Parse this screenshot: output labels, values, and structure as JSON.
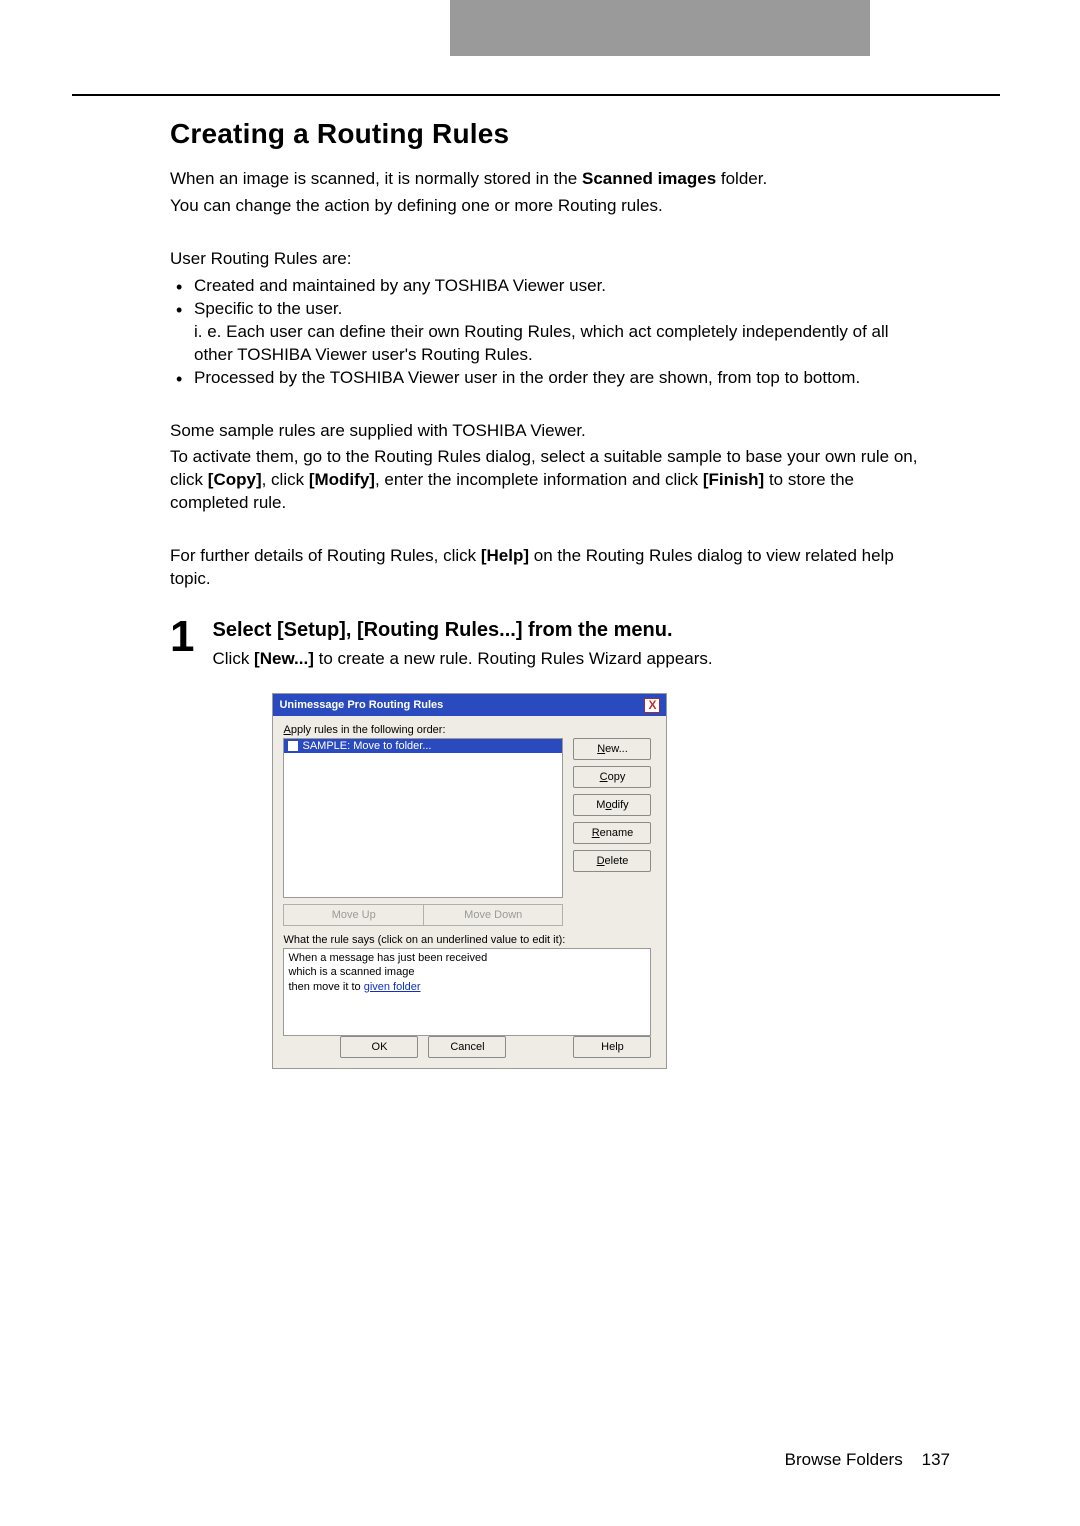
{
  "headerTab": "",
  "title": "Creating a Routing Rules",
  "intro1_pre": "When an image is scanned, it is normally stored in the ",
  "intro1_bold": "Scanned images",
  "intro1_post": " folder.",
  "intro2": "You can change the action by defining one or more Routing rules.",
  "rulesLabel": "User Routing Rules are:",
  "bullets": {
    "b1": "Created and maintained by any TOSHIBA Viewer user.",
    "b2": "Specific to the user.",
    "b2sub": "i. e. Each user can define their own Routing Rules, which act completely independently of all other TOSHIBA Viewer user's Routing Rules.",
    "b3": "Processed by the TOSHIBA Viewer user in the order they are shown, from top to bottom."
  },
  "sampleP1": "Some sample rules are supplied with TOSHIBA Viewer.",
  "sampleP2_pre": "To activate them, go to the Routing Rules dialog, select a suitable sample to base your own rule on, click ",
  "sampleP2_copy": "[Copy]",
  "sampleP2_mid1": ", click ",
  "sampleP2_modify": "[Modify]",
  "sampleP2_mid2": ", enter the incomplete information and click ",
  "sampleP2_finish": "[Finish]",
  "sampleP2_post": " to store the completed rule.",
  "helpP_pre": "For further details of Routing Rules, click ",
  "helpP_bold": "[Help]",
  "helpP_post": " on the Routing Rules dialog to view related help topic.",
  "step": {
    "num": "1",
    "title": "Select [Setup], [Routing Rules...] from the menu.",
    "body_pre": "Click ",
    "body_bold": "[New...]",
    "body_post": " to create a new rule. Routing Rules Wizard appears."
  },
  "dialog": {
    "title": "Unimessage Pro Routing Rules",
    "close": "X",
    "applyLabel_pre": "A",
    "applyLabel_post": "pply rules in the following order:",
    "selectedRule": "SAMPLE: Move to folder...",
    "buttons": {
      "new_u": "N",
      "new_rest": "ew...",
      "copy_u": "C",
      "copy_rest": "opy",
      "modify_pre": "M",
      "modify_u": "o",
      "modify_post": "dify",
      "rename_u": "R",
      "rename_rest": "ename",
      "delete_u": "D",
      "delete_rest": "elete"
    },
    "moveUp_pre": "Move ",
    "moveUp_u": "U",
    "moveUp_post": "p",
    "moveDown_pre": "Move Do",
    "moveDown_u": "w",
    "moveDown_post": "n",
    "descLabel": "What the rule says (click on an underlined value to edit it):",
    "descLine1": "When a message has just been received",
    "descLine2": "which is a scanned image",
    "descLine3_pre": "then move it to ",
    "descLine3_link": "given folder",
    "ok": "OK",
    "cancel": "Cancel",
    "help": "Help"
  },
  "footer": {
    "section": "Browse Folders",
    "page": "137"
  }
}
